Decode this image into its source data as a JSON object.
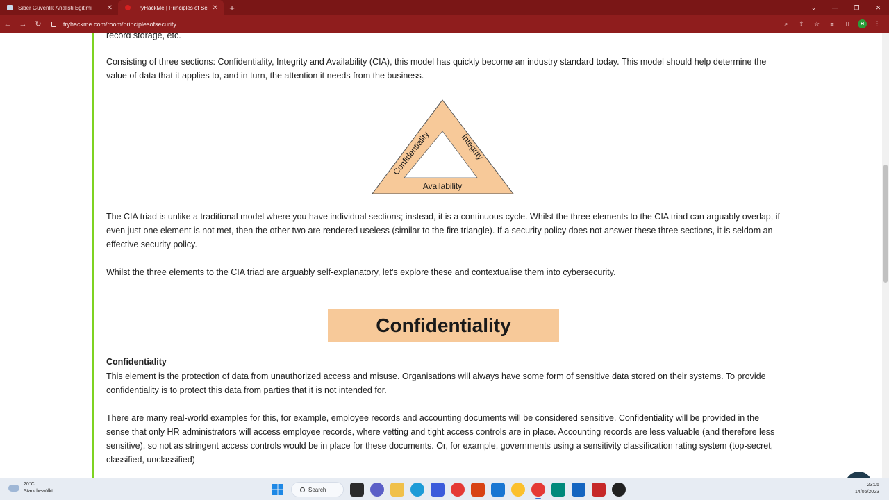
{
  "browser": {
    "tabs": [
      {
        "title": "Siber Güvenlik Analisti Eğitimi",
        "active": false
      },
      {
        "title": "TryHackMe | Principles of Securit",
        "active": true
      }
    ],
    "new_tab_symbol": "+",
    "url": "tryhackme.com/room/principlesofsecurity",
    "profile_initial": "H"
  },
  "content": {
    "top_fragment": "record storage, etc.",
    "intro": "Consisting of three sections: Confidentiality, Integrity and Availability (CIA), this model has quickly become an industry standard today. This model should help determine the value of data that it applies to, and in turn, the attention it needs from the business.",
    "diagram": {
      "left_label": "Confidentiality",
      "right_label": "Integrity",
      "bottom_label": "Availability",
      "fill_color": "#f7c999"
    },
    "triad_para": "The CIA triad is unlike a traditional model where you have individual sections; instead, it is a continuous cycle. Whilst the three elements to the CIA triad can arguably overlap, if even just one element is not met, then the other two are rendered useless (similar to the fire triangle). If a security policy does not answer these three sections, it is seldom an effective security policy.",
    "explore_para": "Whilst the three elements to the CIA triad are arguably self-explanatory, let's explore these and contextualise them into cybersecurity.",
    "banner_title": "Confidentiality",
    "section_heading": "Confidentiality",
    "conf_para1": "This element is the protection of data from unauthorized access and misuse. Organisations will always have some form of sensitive data stored on their systems. To provide confidentiality is to protect this data from parties that it is not intended for.",
    "conf_para2": "There are many real-world examples for this, for example, employee records and accounting documents will be considered sensitive. Confidentiality will be provided in the sense that only HR administrators will access employee records, where vetting and tight access controls are in place. Accounting records are less valuable (and therefore less sensitive), so not as stringent access controls would be in place for these documents. Or, for example, governments using a sensitivity classification rating system (top-secret, classified, unclassified)"
  },
  "taskbar": {
    "weather_temp": "20°C",
    "weather_desc": "Stark bewölkt",
    "search_label": "Search",
    "time": "23:05",
    "date": "14/06/2023"
  },
  "colors": {
    "browser_frame": "#8f1d1d",
    "card_accent": "#7ed321",
    "banner": "#f7c999"
  }
}
